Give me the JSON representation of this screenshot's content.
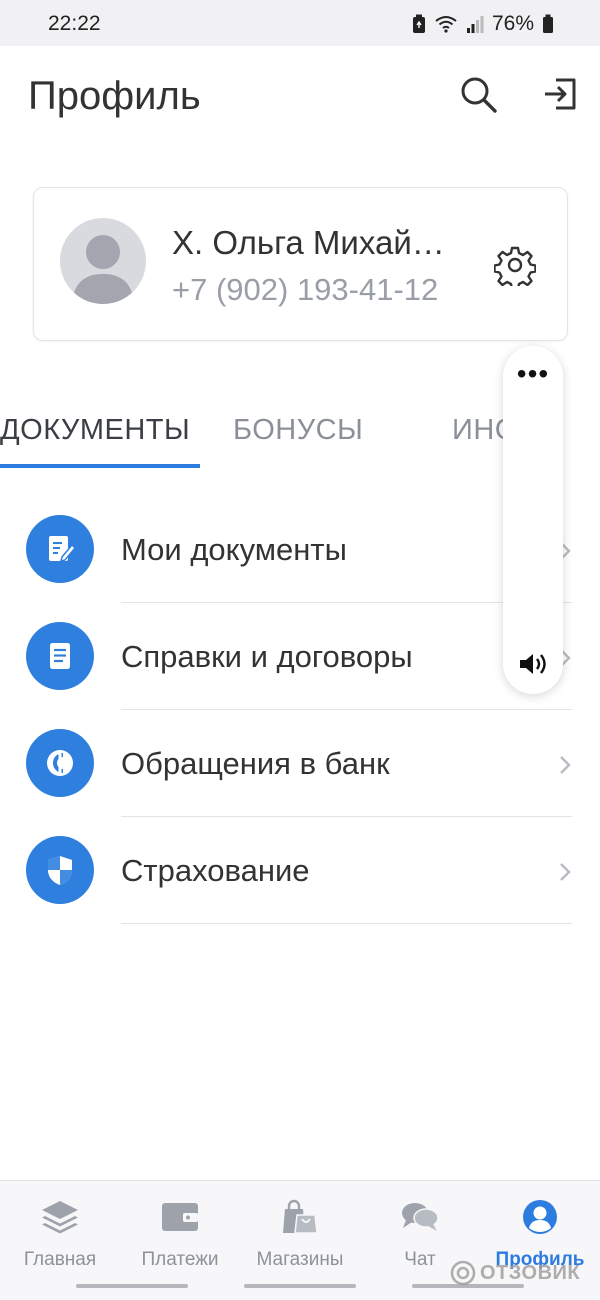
{
  "status_bar": {
    "time": "22:22",
    "battery_percent": "76%",
    "icons": [
      "battery-saver-icon",
      "wifi-icon",
      "signal-icon",
      "battery-icon"
    ]
  },
  "header": {
    "title": "Профиль",
    "actions": [
      "search-icon",
      "logout-icon"
    ]
  },
  "profile": {
    "name": "Х. Ольга Михай…",
    "phone": "+7 (902) 193-41-12",
    "settings_icon": "gear-icon"
  },
  "tabs": [
    {
      "label": "ДОКУМЕНТЫ",
      "active": true
    },
    {
      "label": "БОНУСЫ",
      "active": false
    },
    {
      "label": "ИНС",
      "active": false
    }
  ],
  "menu": {
    "items": [
      {
        "label": "Мои документы",
        "icon": "document-edit-icon"
      },
      {
        "label": "Справки и договоры",
        "icon": "document-list-icon"
      },
      {
        "label": "Обращения в банк",
        "icon": "bank-request-icon"
      },
      {
        "label": "Страхование",
        "icon": "shield-icon"
      }
    ]
  },
  "volume_panel": {
    "more_label": "•••",
    "icon": "speaker-icon"
  },
  "bottom_nav": {
    "items": [
      {
        "label": "Главная",
        "icon": "layers-icon",
        "active": false
      },
      {
        "label": "Платежи",
        "icon": "wallet-icon",
        "active": false
      },
      {
        "label": "Магазины",
        "icon": "shopping-bags-icon",
        "active": false
      },
      {
        "label": "Чат",
        "icon": "chat-icon",
        "active": false
      },
      {
        "label": "Профиль",
        "icon": "user-icon",
        "active": true
      }
    ]
  },
  "watermark": {
    "text": "ОТЗОВИК"
  },
  "colors": {
    "accent": "#2d7ce0",
    "icon_circle": "#2f7fdf",
    "text_primary": "#333333",
    "text_secondary": "#9a9ea6",
    "status_bar_bg": "#f1f1f3"
  }
}
